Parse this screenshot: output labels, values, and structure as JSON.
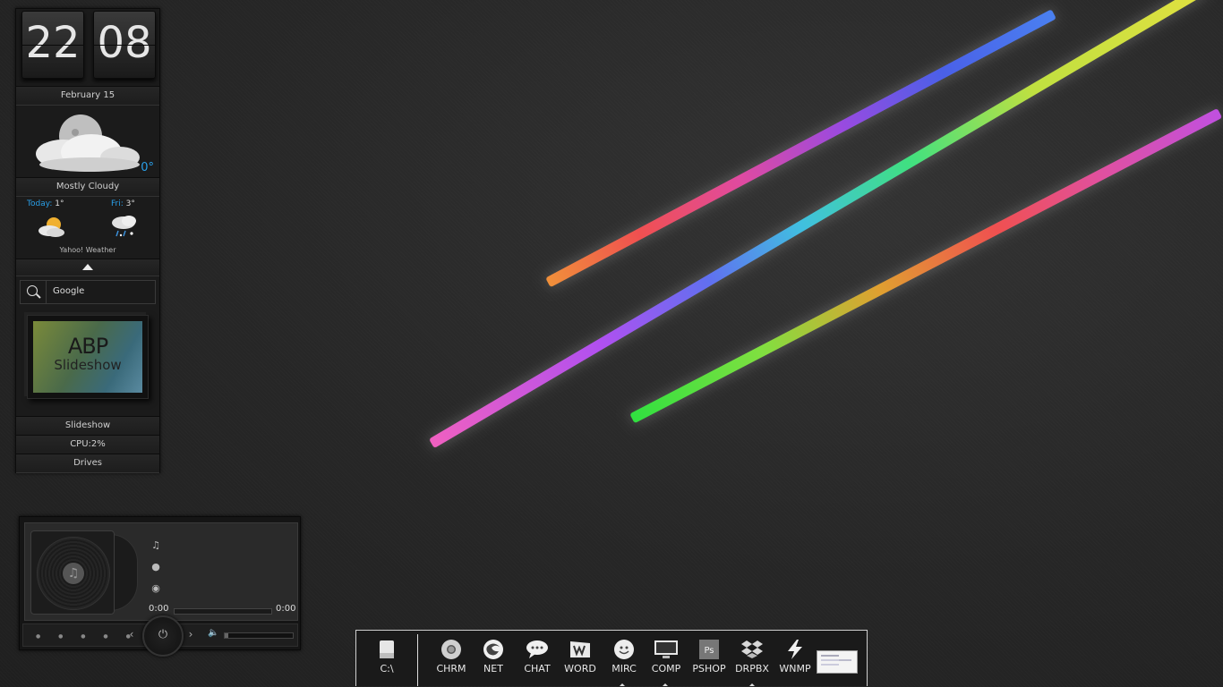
{
  "clock": {
    "hour": "22",
    "minute": "08"
  },
  "date": "February  15",
  "weather": {
    "current_temp": "0°",
    "condition": "Mostly Cloudy",
    "today_label": "Today:",
    "today_temp": "1°",
    "fri_label": "Fri:",
    "fri_temp": "3°",
    "provider": "Yahoo! Weather",
    "icons": {
      "current": "cloudy-moon-icon",
      "today": "partly-sunny-icon",
      "fri": "snow-rain-icon"
    }
  },
  "search": {
    "placeholder": "Google"
  },
  "slideshow": {
    "image_title": "ABP",
    "image_subtitle": "Slideshow",
    "label": "Slideshow"
  },
  "system": {
    "cpu": "CPU:2%",
    "drives": "Drives"
  },
  "player": {
    "current_time": "0:00",
    "total_time": "0:00",
    "progress": 0,
    "volume": 0.05,
    "icons": {
      "prev": "prev-icon",
      "next": "next-icon",
      "power": "power-icon",
      "volume": "volume-icon"
    }
  },
  "dock": {
    "drive": {
      "label": "C:\\",
      "icon": "drive-icon"
    },
    "apps": [
      {
        "label": "CHRM",
        "icon": "chrome-icon"
      },
      {
        "label": "NET",
        "icon": "firefox-icon"
      },
      {
        "label": "CHAT",
        "icon": "chat-icon"
      },
      {
        "label": "WORD",
        "icon": "word-icon"
      },
      {
        "label": "MIRC",
        "icon": "mirc-icon"
      },
      {
        "label": "COMP",
        "icon": "computer-icon"
      },
      {
        "label": "PSHOP",
        "icon": "photoshop-icon"
      },
      {
        "label": "DRPBX",
        "icon": "dropbox-icon"
      },
      {
        "label": "WNMP",
        "icon": "winamp-icon"
      }
    ],
    "colors": {
      "border": "#cfcfcf",
      "accent": "#2a9fe8"
    }
  }
}
